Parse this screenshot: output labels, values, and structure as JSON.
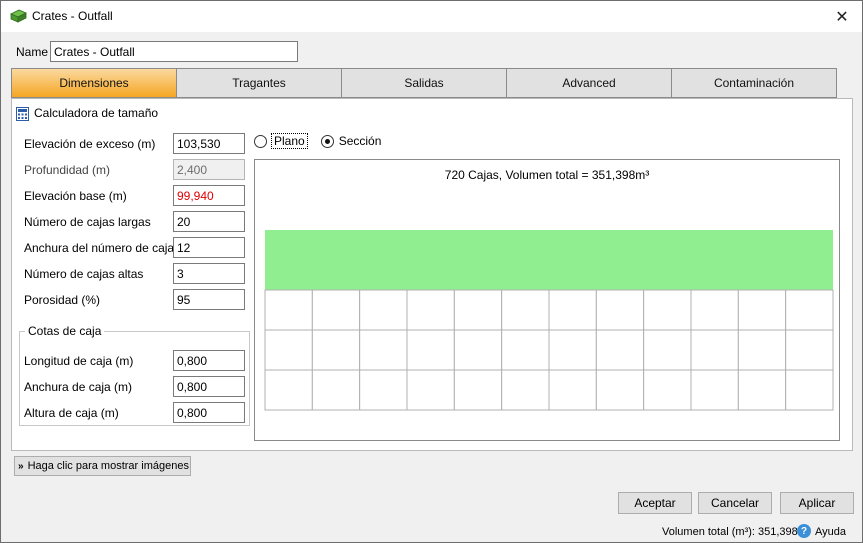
{
  "window": {
    "title": "Crates - Outfall",
    "close_glyph": "✕",
    "icon": "crate-icon"
  },
  "name_field": {
    "label": "Name",
    "value": "Crates - Outfall"
  },
  "tabs": [
    {
      "label": "Dimensiones",
      "active": true
    },
    {
      "label": "Tragantes",
      "active": false
    },
    {
      "label": "Salidas",
      "active": false
    },
    {
      "label": "Advanced",
      "active": false
    },
    {
      "label": "Contaminación",
      "active": false
    }
  ],
  "calculator": {
    "title": "Calculadora de tamaño",
    "icon": "calculator-icon",
    "fields": [
      {
        "label": "Elevación de exceso (m)",
        "value": "103,530"
      },
      {
        "label": "Profundidad (m)",
        "value": "2,400",
        "disabled": true
      },
      {
        "label": "Elevación base (m)",
        "value": "99,940",
        "color": "#e00000"
      },
      {
        "label": "Número de cajas largas",
        "value": "20"
      },
      {
        "label": "Anchura del número de cajas",
        "value": "12"
      },
      {
        "label": "Número de cajas altas",
        "value": "3"
      },
      {
        "label": "Porosidad (%)",
        "value": "95"
      }
    ],
    "box_dimensions": {
      "title": "Cotas de caja",
      "fields": [
        {
          "label": "Longitud de caja (m)",
          "value": "0,800"
        },
        {
          "label": "Anchura de caja (m)",
          "value": "0,800"
        },
        {
          "label": "Altura de caja (m)",
          "value": "0,800"
        }
      ]
    }
  },
  "view_mode": {
    "options": [
      {
        "label": "Plano",
        "checked": false
      },
      {
        "label": "Sección",
        "checked": true
      }
    ]
  },
  "section_view": {
    "summary": "720 Cajas, Volumen total = 351,398m³",
    "columns": 12,
    "rows": 3,
    "fill_color": "#90ee90",
    "grid_color": "#b0b0b0"
  },
  "expand_button": {
    "label": "Haga clic para mostrar imágenes",
    "icon": "double-chevron-down-icon"
  },
  "buttons": {
    "ok": "Aceptar",
    "cancel": "Cancelar",
    "apply": "Aplicar"
  },
  "status_bar": {
    "volume": "Volumen total (m³): 351,398",
    "help": "Ayuda",
    "help_icon": "question-icon"
  }
}
